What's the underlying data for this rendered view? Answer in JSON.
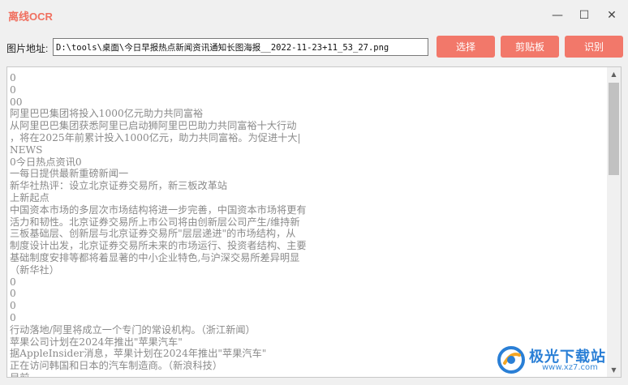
{
  "window": {
    "title": "离线OCR",
    "minimize_glyph": "—",
    "maximize_glyph": "☐",
    "close_glyph": "✕"
  },
  "toolbar": {
    "path_label": "图片地址:",
    "path_value": "D:\\tools\\桌面\\今日早报热点新闻资讯通知长图海报__2022-11-23+11_53_27.png",
    "select_label": "选择",
    "clipboard_label": "剪贴板",
    "recognize_label": "识别"
  },
  "ocr": {
    "text": "0\n0\n00\n阿里巴巴集团将投入1000亿元助力共同富裕\n从阿里巴巴集团获悉阿里已启动狮阿里巴巴助力共同富裕十大行动\n，将在2025年前累计投入1000亿元，助力共同富裕。为促进十大|\nNEWS\n0今日热点资讯0\n一每日提供最新重磅新闻一\n新华社热评：设立北京证券交易所，新三板改革站\n上新起点\n中国资本市场的多层次市场结构将进一步完善，中国资本市场将更有\n活力和韧性。北京证券交易所上市公司将由创新层公司产生/维持新\n三板基础层、创新层与北京证券交易所\"层层递进\"的市场结构，从\n制度设计出发，北京证券交易所未来的市场运行、投资者结构、主要\n基础制度安排等都将着显著的中小企业特色,与沪深交易所差异明显\n（新华社）\n0\n0\n0\n0\n行动落地/阿里将成立一个专门的常设机构。（浙江新闻）\n苹果公司计划在2024年推出\"苹果汽车\"\n据AppleInsider消息，苹果计划在2024年推出\"苹果汽车\"\n正在访问韩国和日本的汽车制造商。（新浪科技）\n目前\n"
  },
  "scrollbar": {
    "up_glyph": "▲",
    "down_glyph": "▼"
  },
  "watermark": {
    "name": "极光下载站",
    "url": "www.xz7.com"
  },
  "colors": {
    "accent": "#f2786a",
    "title": "#f07060",
    "text": "#8a8a8a"
  }
}
